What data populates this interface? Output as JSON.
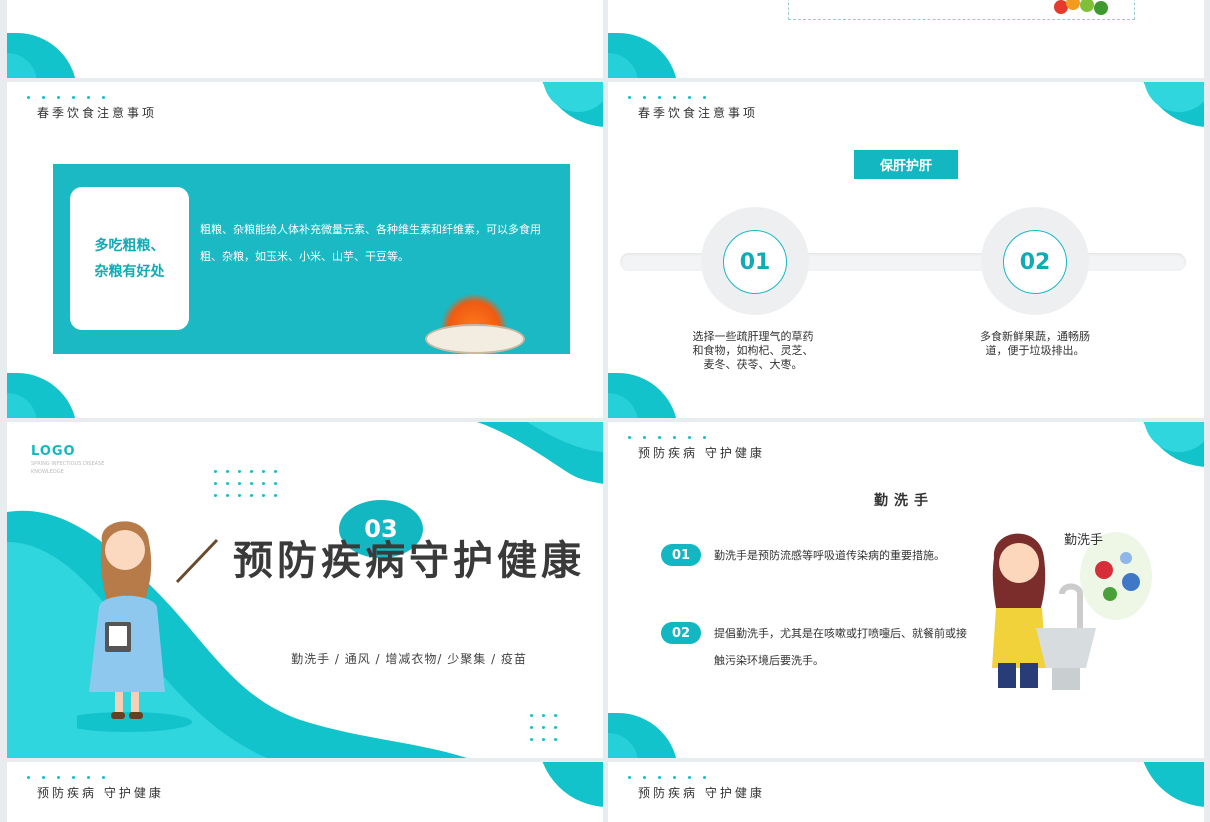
{
  "slide_spring_diet": {
    "header": "春季饮食注意事项",
    "card_title_line1": "多吃粗粮、",
    "card_title_line2": "杂粮有好处",
    "description": "粗粮、杂粮能给人体补充微量元素、各种维生素和纤维素，可以多食用粗、杂粮，如玉米、小米、山芋、干豆等。"
  },
  "slide_liver": {
    "header": "春季饮食注意事项",
    "badge": "保肝护肝",
    "points": [
      {
        "num": "01",
        "text": "选择一些疏肝理气的草药和食物，如枸杞、灵芝、麦冬、茯苓、大枣。"
      },
      {
        "num": "02",
        "text": "多食新鲜果蔬，通畅肠道，便于垃圾排出。"
      }
    ]
  },
  "slide_section": {
    "logo": "LOGO",
    "logo_sub": "SPRING INFECTIOUS DISEASE KNOWLEDGE",
    "number": "03",
    "title": "预防疾病守护健康",
    "subtitle": "勤洗手 / 通风 / 增减衣物/ 少聚集 / 疫苗"
  },
  "slide_handwash": {
    "header": "预防疾病 守护健康",
    "subtitle": "勤洗手",
    "illustration_label": "勤洗手",
    "items": [
      {
        "num": "01",
        "text": "勤洗手是预防流感等呼吸道传染病的重要措施。"
      },
      {
        "num": "02",
        "text": "提倡勤洗手，尤其是在咳嗽或打喷嚏后、就餐前或接触污染环境后要洗手。"
      }
    ]
  },
  "slide_bottom_left": {
    "header": "预防疾病 守护健康"
  },
  "slide_bottom_right": {
    "header": "预防疾病 守护健康"
  },
  "colors": {
    "accent": "#12b7c2",
    "accent_light": "#2fd6de",
    "text": "#333333"
  }
}
